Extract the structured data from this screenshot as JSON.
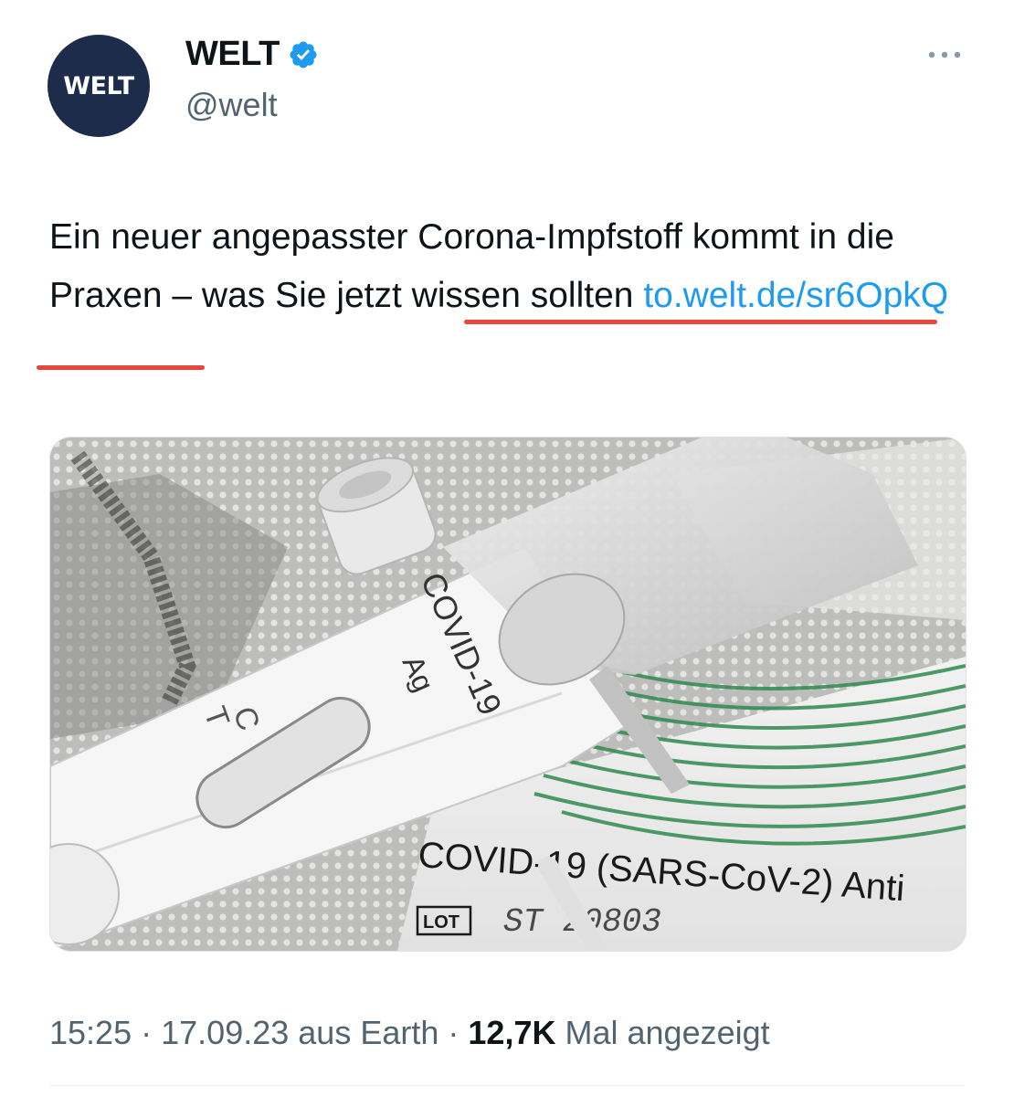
{
  "account": {
    "avatar_text": "WELT",
    "display_name": "WELT",
    "handle": "@welt",
    "verified": true
  },
  "tweet": {
    "text_part1": "Ein neuer angepasster Corona-Impfstoff kommt in die Praxen – was Sie jetzt wissen sollten ",
    "link": "to.welt.de/sr6OpkQ"
  },
  "media": {
    "image_texts": {
      "test_name": "COVID-19",
      "test_sub": "Ag",
      "control": "C",
      "test_line": "T",
      "box_label": "COVID-19 (SARS-CoV-2) Anti",
      "lot_label": "LOT",
      "lot_number": "ST 20803"
    }
  },
  "meta": {
    "time": "15:25",
    "separator": "·",
    "date": "17.09.23",
    "source": "aus Earth",
    "views": "12,7K",
    "views_label": "Mal angezeigt"
  },
  "colors": {
    "link": "#1d9bf0",
    "verified": "#1d9bf0",
    "annotation": "#e8483b",
    "avatar_bg": "#1c2c4a"
  },
  "icons": [
    "verified-badge-icon",
    "more-options-icon"
  ]
}
